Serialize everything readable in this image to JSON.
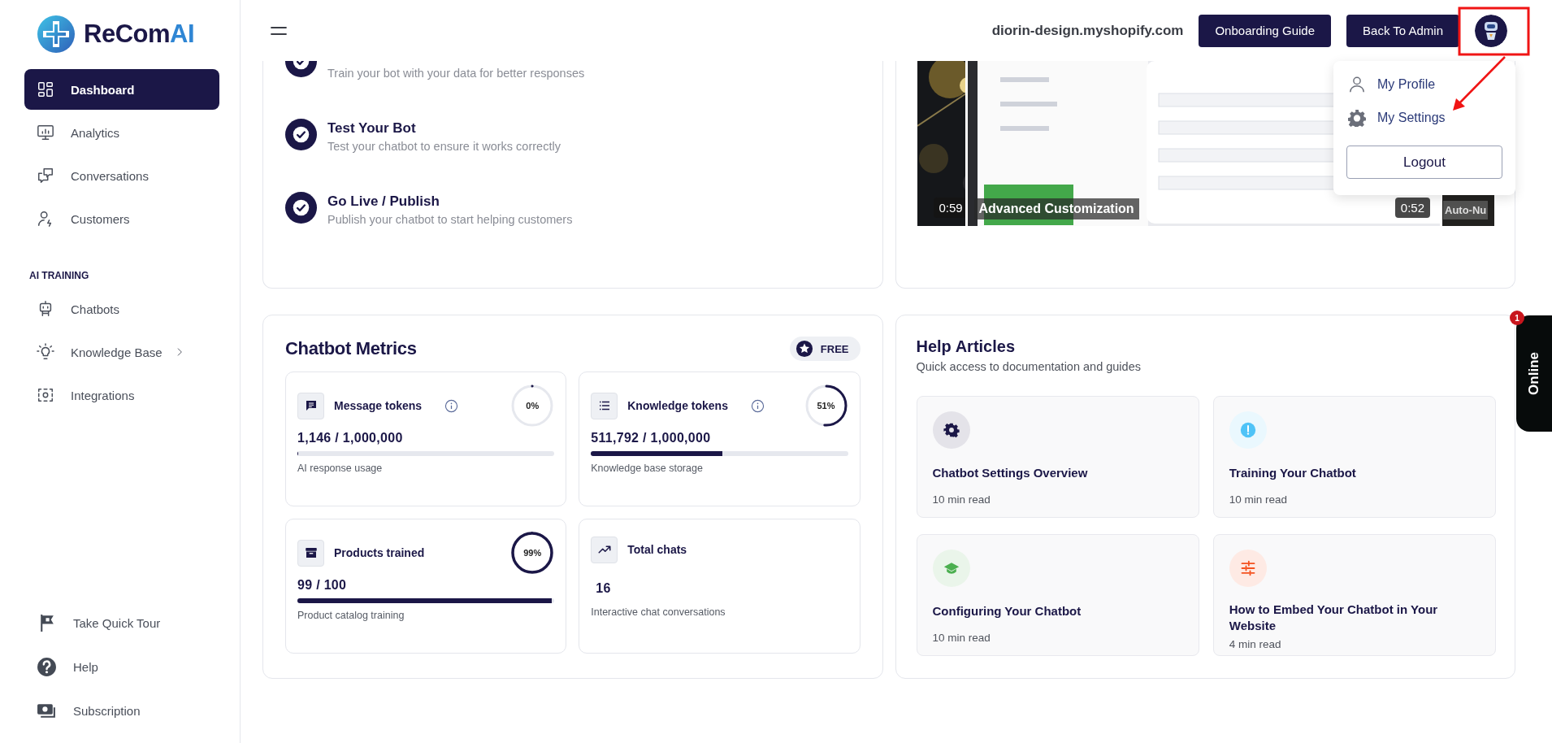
{
  "brand": {
    "name": "ReCom",
    "accent": "AI"
  },
  "sidebar": {
    "items": [
      {
        "label": "Dashboard",
        "selected": true
      },
      {
        "label": "Analytics",
        "selected": false
      },
      {
        "label": "Conversations",
        "selected": false
      },
      {
        "label": "Customers",
        "selected": false
      }
    ],
    "section": {
      "title": "AI TRAINING",
      "items": [
        {
          "label": "Chatbots",
          "selected": false,
          "expandable": false
        },
        {
          "label": "Knowledge Base",
          "selected": false,
          "expandable": true
        },
        {
          "label": "Integrations",
          "selected": false,
          "expandable": false
        }
      ]
    },
    "footer_items": [
      {
        "label": "Take Quick Tour"
      },
      {
        "label": "Help"
      },
      {
        "label": "Subscription"
      }
    ]
  },
  "header": {
    "store": "diorin-design.myshopify.com",
    "buttons": [
      "Onboarding Guide",
      "Back To Admin"
    ]
  },
  "user_menu": {
    "open": true,
    "items": [
      "My Profile",
      "My Settings"
    ],
    "logout": "Logout"
  },
  "onboarding": {
    "steps": [
      {
        "description": "Train your bot with your data for better responses",
        "completed": true
      },
      {
        "title": "Test Your Bot",
        "description": "Test your chatbot to ensure it works correctly",
        "completed": true
      },
      {
        "title": "Go Live / Publish",
        "description": "Publish your chatbot to start helping customers",
        "completed": true
      }
    ]
  },
  "videos": [
    {
      "kind": "picture",
      "duration": "0:59"
    },
    {
      "kind": "picture",
      "title": "Advanced Customization",
      "duration": "0:52"
    },
    {
      "kind": "picture",
      "title": "Auto-Nu"
    }
  ],
  "metrics": {
    "title": "Chatbot Metrics",
    "plan": "FREE",
    "items": [
      {
        "kind": "usage",
        "title": "Message tokens",
        "info": true,
        "percent": "0%",
        "level": 0.0011,
        "value": "1,146 / 1,000,000",
        "caption": "AI response usage"
      },
      {
        "kind": "usage",
        "title": "Knowledge tokens",
        "info": true,
        "percent": "51%",
        "level": 0.5118,
        "value": "511,792 / 1,000,000",
        "caption": "Knowledge base storage"
      },
      {
        "kind": "usage",
        "title": "Products trained",
        "info": false,
        "percent": "99%",
        "level": 0.99,
        "value": "99 / 100",
        "caption": "Product catalog training"
      },
      {
        "kind": "count",
        "title": "Total chats",
        "value": "16",
        "caption": "Interactive chat conversations"
      }
    ]
  },
  "help": {
    "title": "Help Articles",
    "subtitle": "Quick access to documentation and guides",
    "articles": [
      {
        "title": "Chatbot Settings Overview",
        "read_time": "10 min read",
        "color": "#1b1747"
      },
      {
        "title": "Training Your Chatbot",
        "read_time": "10 min read",
        "color": "#4fc3f7"
      },
      {
        "title": "Configuring Your Chatbot",
        "read_time": "10 min read",
        "color": "#4caf50"
      },
      {
        "title": "How to Embed Your Chatbot in Your Website",
        "read_time": "4 min read",
        "color": "#f4511e"
      }
    ]
  },
  "chat_widget": {
    "label": "Online",
    "badge": "1"
  },
  "callout": {
    "shown": true
  }
}
